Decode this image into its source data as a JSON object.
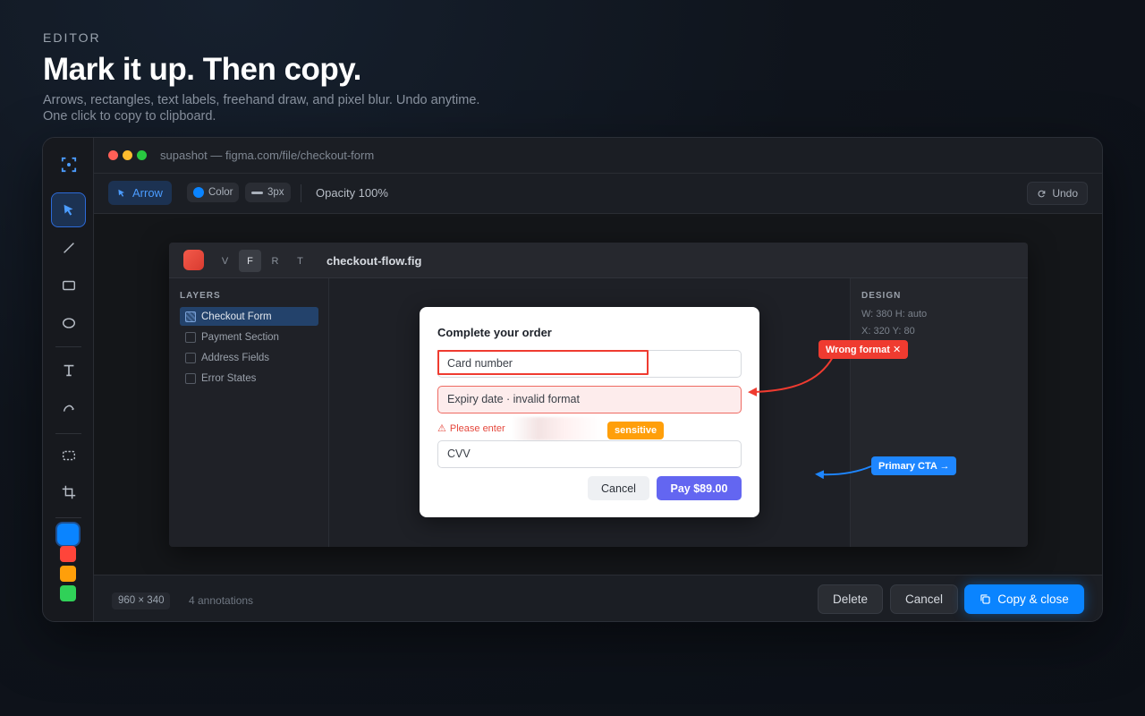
{
  "hero": {
    "eyebrow": "EDITOR",
    "title": "Mark it up. Then copy.",
    "subtitle_line1": "Arrows, rectangles, text labels, freehand draw, and pixel blur. Undo anytime.",
    "subtitle_line2": "One click to copy to clipboard."
  },
  "colors": {
    "accent": "#0a84ff",
    "red": "#ff453a",
    "orange": "#ff9f0a",
    "green": "#30d158"
  },
  "rail": {
    "tools": [
      "app-logo-icon",
      "arrow-cursor-icon",
      "line-icon",
      "rectangle-icon",
      "ellipse-icon",
      "text-icon",
      "freehand-icon",
      "blur-select-icon",
      "crop-icon"
    ],
    "swatches": [
      "#0a84ff",
      "#ff453a",
      "#ff9f0a",
      "#30d158"
    ]
  },
  "window": {
    "title": "supashot — figma.com/file/checkout-form"
  },
  "toolbar": {
    "arrow_label": "Arrow",
    "color_label": "Color",
    "stroke_label": "3px",
    "opacity_label": "Opacity 100%",
    "undo_label": "Undo"
  },
  "shot": {
    "tabs": [
      "V",
      "F",
      "R",
      "T"
    ],
    "active_tab": "F",
    "file_name": "checkout-flow.fig",
    "layers_title": "LAYERS",
    "layers": [
      "Checkout Form",
      "Payment Section",
      "Address Fields",
      "Error States"
    ],
    "design_title": "DESIGN",
    "design_size": "W: 380 H: auto",
    "design_pos": "X: 320 Y: 80",
    "modal": {
      "title": "Complete your order",
      "card_placeholder": "Card number",
      "expiry_value": "Expiry date · invalid format",
      "error_text": "Please enter",
      "cvv_placeholder": "CVV",
      "cancel_label": "Cancel",
      "pay_label": "Pay $89.00"
    }
  },
  "annotations": {
    "wrong_format": "Wrong format ✕",
    "sensitive": "sensitive",
    "primary_cta": "Primary CTA →"
  },
  "footer": {
    "dimensions": "960 × 340",
    "annotation_count": "4 annotations",
    "delete_label": "Delete",
    "cancel_label": "Cancel",
    "copy_label": "Copy & close"
  }
}
